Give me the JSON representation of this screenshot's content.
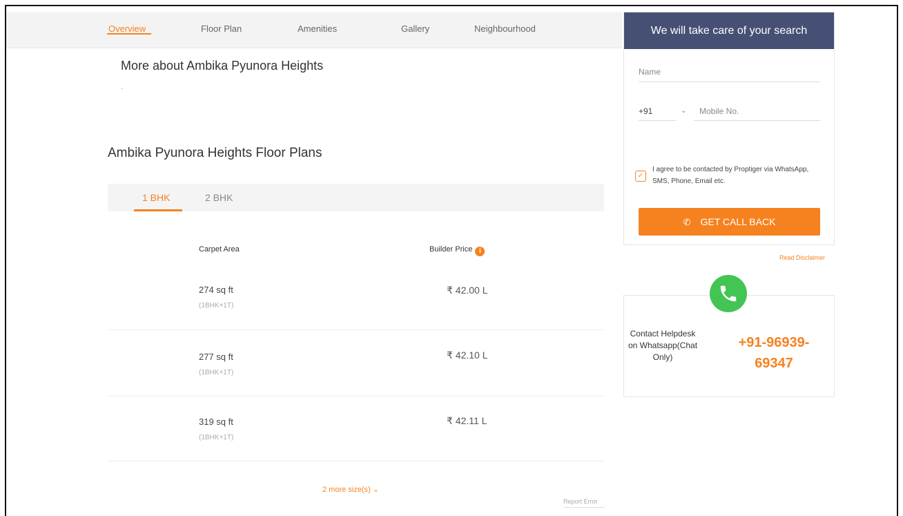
{
  "nav": {
    "items": [
      {
        "label": "Overview",
        "active": true
      },
      {
        "label": "Floor Plan",
        "active": false
      },
      {
        "label": "Amenities",
        "active": false
      },
      {
        "label": "Gallery",
        "active": false
      },
      {
        "label": "Neighbourhood",
        "active": false
      }
    ]
  },
  "about": {
    "title": "More about Ambika Pyunora Heights",
    "text": "."
  },
  "floor_plans": {
    "title": "Ambika Pyunora Heights Floor Plans",
    "tabs": [
      {
        "label": "1 BHK",
        "active": true
      },
      {
        "label": "2 BHK",
        "active": false
      }
    ],
    "columns": {
      "area": "Carpet Area",
      "price": "Builder Price"
    },
    "rows": [
      {
        "area": "274 sq ft",
        "type": "(1BHK+1T)",
        "price": "₹ 42.00 L"
      },
      {
        "area": "277 sq ft",
        "type": "(1BHK+1T)",
        "price": "₹ 42.10 L"
      },
      {
        "area": "319 sq ft",
        "type": "(1BHK+1T)",
        "price": "₹ 42.11 L"
      }
    ],
    "more_label": "2 more size(s)",
    "report_label": "Report Error"
  },
  "form": {
    "title": "We will take care of your search",
    "name_placeholder": "Name",
    "country_code": "+91",
    "mobile_placeholder": "Mobile No.",
    "agree_text": "I agree to be contacted by Proptiger via WhatsApp, SMS, Phone, Email etc.",
    "agree_checked": true,
    "cta_label": "GET CALL BACK",
    "disclaimer": "Read Disclaimer"
  },
  "whatsapp": {
    "text": "Contact Helpdesk on Whatsapp(Chat Only)",
    "phone": "+91-96939-69347"
  },
  "colors": {
    "accent": "#f5821f",
    "header": "#465075",
    "whatsapp": "#43c553"
  },
  "icons": [
    "info-icon",
    "check-icon",
    "chevron-down-icon",
    "phone-icon",
    "whatsapp-icon"
  ]
}
